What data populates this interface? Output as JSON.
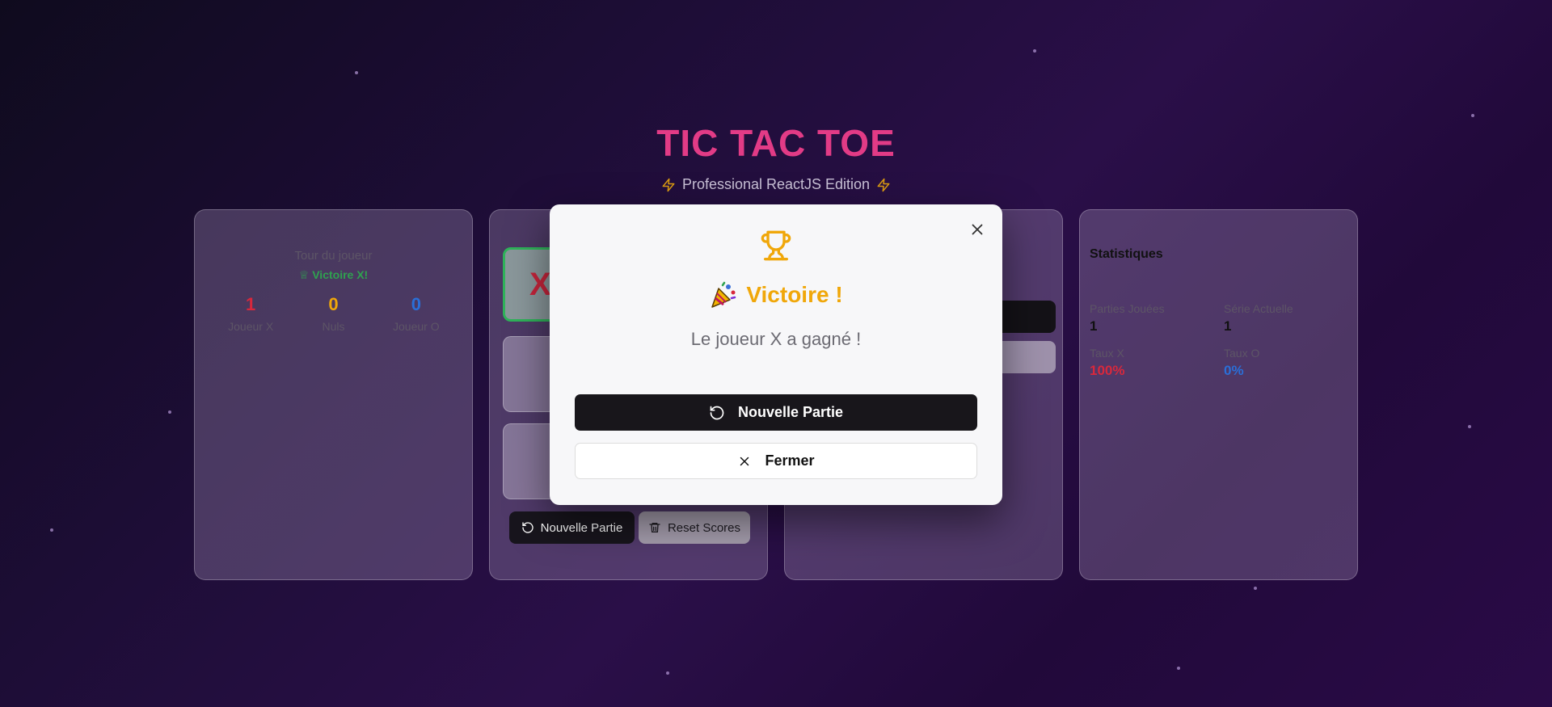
{
  "header": {
    "title": "TIC TAC TOE",
    "subtitle": "Professional ReactJS Edition"
  },
  "players_panel": {
    "turn_label": "Tour du joueur",
    "turn_status": "Victoire X!",
    "scores": [
      {
        "value": "1",
        "label": "Joueur X",
        "color": "#d8283c"
      },
      {
        "value": "0",
        "label": "Nuls",
        "color": "#f0a70a"
      },
      {
        "value": "0",
        "label": "Joueur O",
        "color": "#2a6fd8"
      }
    ]
  },
  "board": {
    "visible_cell": "X",
    "new_game_label": "Nouvelle Partie",
    "reset_label": "Reset Scores"
  },
  "stats": {
    "title": "Statistiques",
    "items": [
      {
        "label": "Parties Jouées",
        "value": "1",
        "color": "#111111"
      },
      {
        "label": "Série Actuelle",
        "value": "1",
        "color": "#111111"
      },
      {
        "label": "Taux X",
        "value": "100%",
        "color": "#d8283c"
      },
      {
        "label": "Taux O",
        "value": "0%",
        "color": "#2a6fd8"
      }
    ]
  },
  "modal": {
    "title": "Victoire !",
    "message": "Le joueur X a gagné !",
    "primary_label": "Nouvelle Partie",
    "secondary_label": "Fermer",
    "accent": "#f0a70a",
    "icons": [
      "trophy-icon",
      "party-popper-icon",
      "close-icon",
      "rotate-ccw-icon"
    ]
  }
}
